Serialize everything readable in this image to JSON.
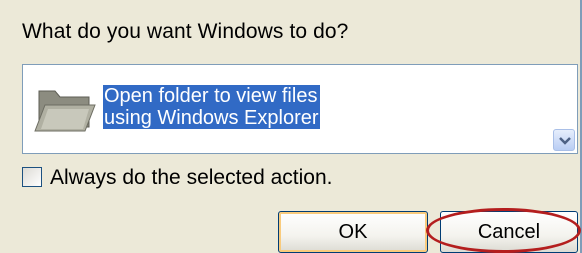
{
  "dialog": {
    "prompt": "What do you want Windows to do?",
    "selected_action": {
      "icon": "folder-icon",
      "text": "Open folder to view files\nusing Windows Explorer"
    },
    "always_checkbox": {
      "label": "Always do the selected action.",
      "checked": false
    },
    "buttons": {
      "ok_label": "OK",
      "cancel_label": "Cancel"
    }
  },
  "annotation": {
    "highlight_color": "#b41e1e",
    "highlighted": "cancel"
  },
  "colors": {
    "background": "#ece9d8",
    "selection": "#316ac5",
    "border": "#7f9db9"
  }
}
